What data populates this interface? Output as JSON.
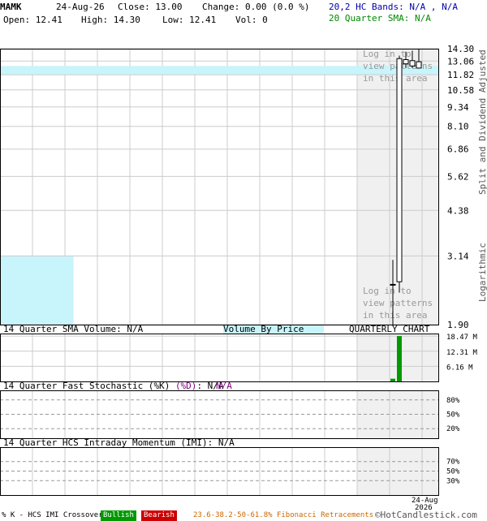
{
  "header": {
    "symbol": "MAMK",
    "date": "24-Aug-26",
    "close_label": "Close: 13.00",
    "change_label": "Change: 0.00 (0.0 %)",
    "open_label": "Open: 12.41",
    "high_label": "High: 14.30",
    "low_label": "Low: 12.41",
    "vol_label": "Vol: 0",
    "bands_label": "20,2 HC Bands: N/A , N/A",
    "sma_label": "20 Quarter SMA: N/A"
  },
  "colors": {
    "candle": "#000000",
    "volume_bar": "#009900",
    "vbp_band": "#c8f4fc",
    "recent_shade": "#f0f0f0",
    "grid": "#cccccc",
    "watermark": "#999999"
  },
  "chart_data": [
    {
      "type": "candlestick",
      "name": "price",
      "scale": "log",
      "ylim": [
        1.9,
        14.3
      ],
      "yticks": [
        "14.30",
        "13.06",
        "11.82",
        "10.58",
        "9.34",
        "8.10",
        "6.86",
        "5.62",
        "4.38",
        "3.14",
        "1.90"
      ],
      "ylabel": "Split and Dividend Adjusted",
      "scale_label": "Logarithmic",
      "candles": [
        {
          "open": 2.55,
          "high": 3.05,
          "low": 1.9,
          "close": 2.55
        },
        {
          "open": 2.6,
          "high": 13.6,
          "low": 2.4,
          "close": 13.3
        },
        {
          "open": 12.8,
          "high": 14.0,
          "low": 12.41,
          "close": 13.2
        },
        {
          "open": 12.6,
          "high": 14.1,
          "low": 12.41,
          "close": 13.1
        },
        {
          "open": 12.41,
          "high": 14.3,
          "low": 12.41,
          "close": 13.0
        }
      ],
      "volume_by_price_bands": [
        {
          "low": 11.82,
          "high": 12.6,
          "length_fraction": 1.0
        },
        {
          "low": 1.9,
          "high": 3.14,
          "length_fraction": 0.166
        }
      ],
      "watermark": [
        "Log in to",
        "view patterns",
        "in this area"
      ]
    },
    {
      "type": "bar",
      "name": "volume",
      "title": "14 Quarter SMA Volume: N/A",
      "vbp_label": "Volume By Price",
      "chart_label": "QUARTERLY CHART",
      "ylim": [
        0,
        19.5
      ],
      "yticks": [
        "18.47 M",
        "12.31 M",
        "6.16 M"
      ],
      "values": [
        1.1,
        18.47,
        0,
        0,
        0
      ]
    },
    {
      "type": "line",
      "name": "stochastic",
      "title_prefix": "14 Quarter Fast Stochastic (",
      "title_k": "%K",
      "title_mid": ") ",
      "title_d": "(%D)",
      "title_na1": ": N/A",
      "title_na2": "N/A",
      "yticks": [
        "80%",
        "50%",
        "20%"
      ]
    },
    {
      "type": "line",
      "name": "momentum",
      "title": "14 Quarter HCS Intraday Momentum (IMI): N/A",
      "yticks": [
        "70%",
        "50%",
        "30%"
      ],
      "xtick_date": "24-Aug",
      "xtick_year": "2026"
    }
  ],
  "footer": {
    "crossover_label": "% K - HCS IMI Crossover,",
    "bullish": "Bullish",
    "bearish": "Bearish",
    "fib_label": "23.6-38.2-50-61.8% Fibonacci Retracements",
    "copyright": "©HotCandlestick.com"
  }
}
